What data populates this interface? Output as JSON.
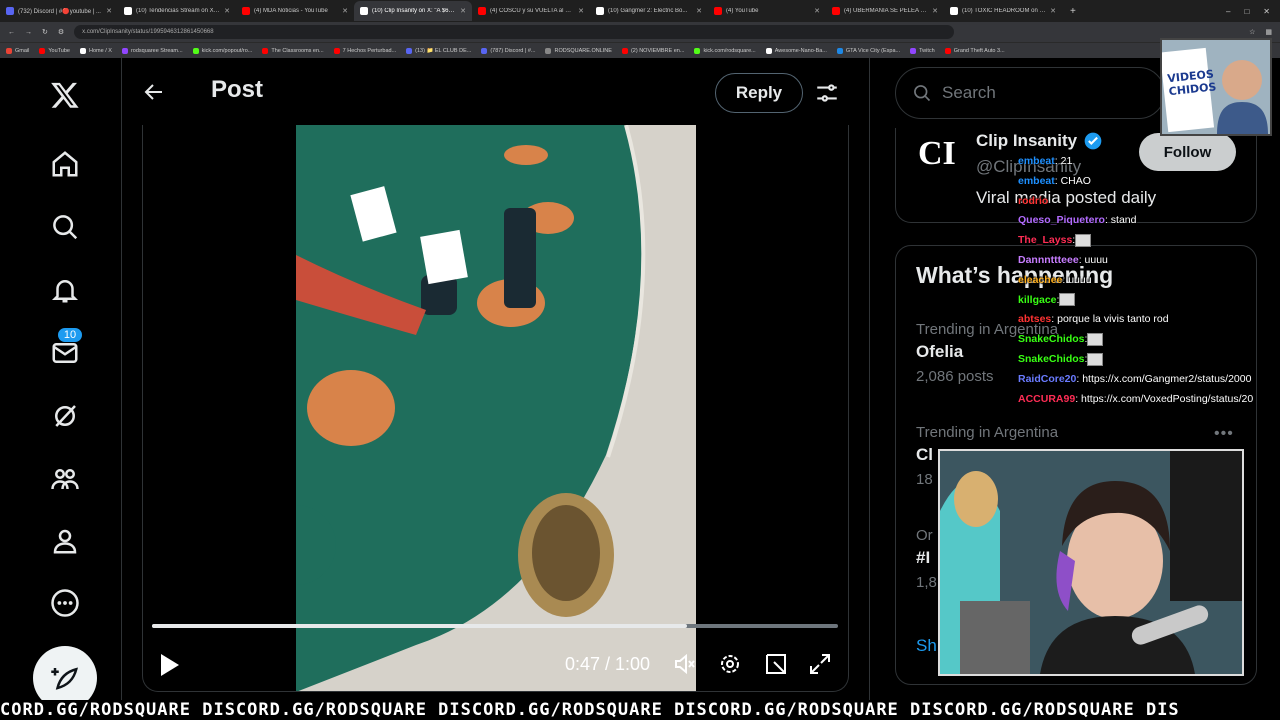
{
  "browser": {
    "tabs": [
      {
        "label": "(732) Discord | #🔴youtube | ...",
        "color": "#5865f2",
        "active": false
      },
      {
        "label": "(10) Tendencias Stream on X: ...",
        "color": "#ffffff",
        "active": false
      },
      {
        "label": "(4) MDA Noticias - YouTube",
        "color": "#ff0000",
        "active": false
      },
      {
        "label": "(10) Clip Insanity on X: \"A $650...",
        "color": "#ffffff",
        "active": true
      },
      {
        "label": "(4) COSCU y su VUELTA al PRIM...",
        "color": "#ff0000",
        "active": false
      },
      {
        "label": "(10) Gangmer 2: Electric Bo...",
        "color": "#ffffff",
        "active": false
      },
      {
        "label": "(4) YouTube",
        "color": "#ff0000",
        "active": false
      },
      {
        "label": "(4) UBERMANIA SE PELEA #fo...",
        "color": "#ff0000",
        "active": false
      },
      {
        "label": "(10) TOXIC HEADROOM on X: \"...",
        "color": "#ffffff",
        "active": false
      }
    ],
    "url": "x.com/ClipInsanity/status/1995946312861450668",
    "bookmarks": [
      {
        "label": "Gmail",
        "color": "#ea4335"
      },
      {
        "label": "YouTube",
        "color": "#ff0000"
      },
      {
        "label": "Home / X",
        "color": "#ffffff"
      },
      {
        "label": "rodsquaree Stream...",
        "color": "#9146ff"
      },
      {
        "label": "kick.com/popout/ro...",
        "color": "#53fc18"
      },
      {
        "label": "The Classrooms en...",
        "color": "#ff0000"
      },
      {
        "label": "7 Hechos Perturbad...",
        "color": "#ff0000"
      },
      {
        "label": "(13) 📁 EL CLUB DE...",
        "color": "#5865f2"
      },
      {
        "label": "(787) Discord | #...",
        "color": "#5865f2"
      },
      {
        "label": "RODSQUARE.ONLINE",
        "color": "#888888"
      },
      {
        "label": "(2) NOVIEMBRE en...",
        "color": "#ff0000"
      },
      {
        "label": "kick.com/rodsquare...",
        "color": "#53fc18"
      },
      {
        "label": "Awesome-Nano-Ba...",
        "color": "#ffffff"
      },
      {
        "label": "GTA Vice City (Espa...",
        "color": "#1e88e5"
      },
      {
        "label": "Twitch",
        "color": "#9146ff"
      },
      {
        "label": "Grand Theft Auto 3...",
        "color": "#ff0000"
      }
    ]
  },
  "nav": {
    "notification_count": "10",
    "icons": [
      "x-logo-icon",
      "home-icon",
      "search-icon",
      "bell-icon",
      "mail-icon",
      "grok-icon",
      "communities-icon",
      "profile-icon",
      "more-icon"
    ]
  },
  "header": {
    "title": "Post",
    "reply_label": "Reply"
  },
  "video": {
    "time": "0:47 / 1:00",
    "progress": 0.78
  },
  "sidebar": {
    "search_placeholder": "Search",
    "profile": {
      "avatar_text": "CI",
      "name": "Clip Insanity",
      "handle": "@ClipInsanity",
      "bio": "Viral media posted daily",
      "follow_label": "Follow"
    },
    "trends_title": "What’s happening",
    "trends": [
      {
        "context": "Trending in Argentina",
        "name": "Ofelia",
        "posts": "2,086 posts"
      },
      {
        "context": "Trending in Argentina",
        "name": "Cl",
        "posts": "18"
      },
      {
        "context": "Or",
        "name": "#I",
        "posts": "1,8"
      }
    ],
    "show_more": "Sh"
  },
  "chat": [
    {
      "user": "embeat",
      "color": "#1e90ff",
      "msg": ": 21"
    },
    {
      "user": "embeat",
      "color": "#1e90ff",
      "msg": ": CHAO"
    },
    {
      "user": "rodrio",
      "color": "#ff3333",
      "msg": ""
    },
    {
      "user": "Queso_Piquetero",
      "color": "#b36bff",
      "msg": ": stand"
    },
    {
      "user": "The_Layss",
      "color": "#ff2d55",
      "msg": ":"
    },
    {
      "user": "Dannnttteee",
      "color": "#c77dff",
      "msg": ": uuuu"
    },
    {
      "user": "eleachee",
      "color": "#ffb020",
      "msg": ": uuuu"
    },
    {
      "user": "killgace",
      "color": "#39ff14",
      "msg": ":"
    },
    {
      "user": "abtses",
      "color": "#ff3333",
      "msg": ": porque la vivis tanto rod"
    },
    {
      "user": "SnakeChidos",
      "color": "#39ff14",
      "msg": ":"
    },
    {
      "user": "SnakeChidos",
      "color": "#39ff14",
      "msg": ":"
    },
    {
      "user": "RaidCore20",
      "color": "#6a7bff",
      "msg": ": https://x.com/Gangmer2/status/2000"
    },
    {
      "user": "ACCURA99",
      "color": "#ff2d55",
      "msg": ": https://x.com/VoxedPosting/status/20"
    }
  ],
  "webcam_small_text": "VIDEOS CHIDOS",
  "ticker": "CORD.GG/RODSQUARE DISCORD.GG/RODSQUARE DISCORD.GG/RODSQUARE DISCORD.GG/RODSQUARE DISCORD.GG/RODSQUARE DIS"
}
